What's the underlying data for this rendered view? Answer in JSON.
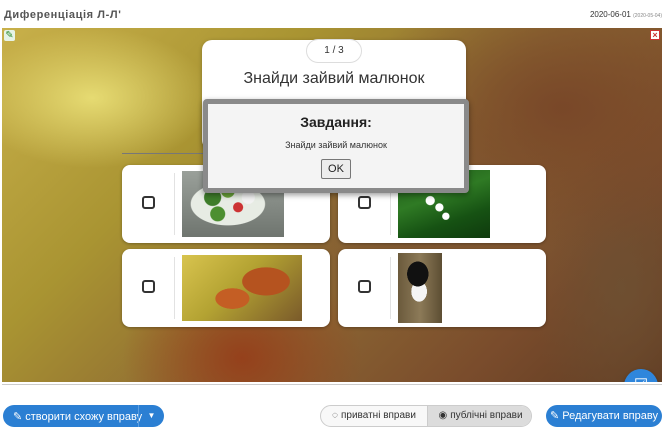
{
  "header": {
    "title": "Диференціація Л-Л'",
    "date": "2020-06-01",
    "date_small": "(2020-05-04)"
  },
  "exercise": {
    "counter": "1 / 3",
    "title": "Знайди зайвий малюнок"
  },
  "options": [
    {
      "image_icon": "salad-image",
      "checked": false
    },
    {
      "image_icon": "lily-of-the-valley-image",
      "checked": false
    },
    {
      "image_icon": "squirrel-image",
      "checked": false
    },
    {
      "image_icon": "woodpecker-image",
      "checked": false
    }
  ],
  "dialog": {
    "heading": "Завдання:",
    "message": "Знайди зайвий малюнок",
    "ok_label": "OK"
  },
  "footer": {
    "create_label": "створити схожу вправу",
    "private_label": "приватні вправи",
    "public_label": "публічні вправи",
    "edit_label": "Редагувати вправу"
  },
  "colors": {
    "accent": "#2b7fd3",
    "fab": "#2f86dc"
  }
}
